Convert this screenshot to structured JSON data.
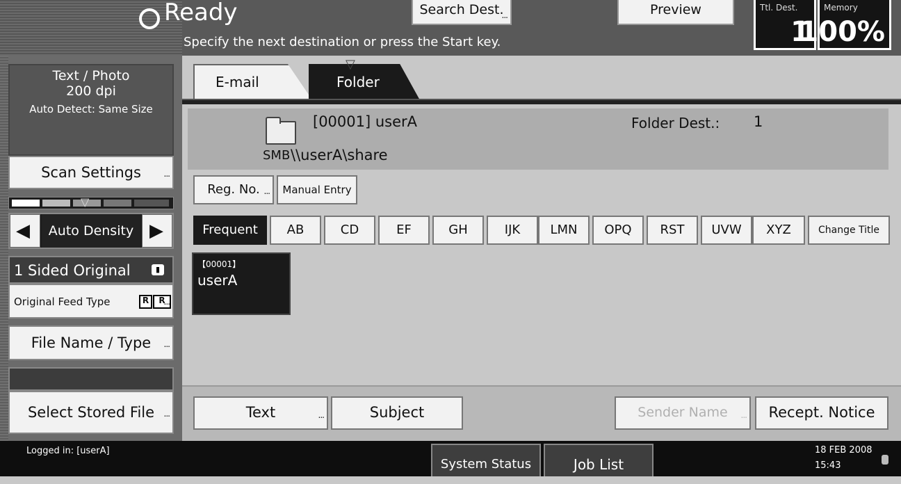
{
  "header": {
    "status": "Ready",
    "message": "Specify the next destination or press the Start key.",
    "search_dest_label": "Search Dest.",
    "preview_label": "Preview",
    "ttl_dest_label": "Ttl. Dest.",
    "ttl_dest_value": "1",
    "memory_label": "Memory",
    "memory_value": "100%"
  },
  "left_panel": {
    "scan_mode": "Text / Photo",
    "resolution": "200 dpi",
    "size_mode": "Auto Detect: Same Size",
    "scan_settings": "Scan Settings",
    "density_label": "Auto Density",
    "sided_original": "1 Sided Original",
    "feed_type": "Original Feed Type",
    "file_name_type": "File Name / Type",
    "select_stored_file": "Select Stored File"
  },
  "tabs": [
    {
      "label": "E-mail",
      "active": false
    },
    {
      "label": "Folder",
      "active": true
    }
  ],
  "destination": {
    "title": "[00001] userA",
    "protocol": "SMB",
    "path": "\\\\userA\\share",
    "count_label": "Folder Dest.:",
    "count_value": "1"
  },
  "entry_buttons": {
    "reg_no": "Reg. No.",
    "manual_entry": "Manual Entry"
  },
  "index_tabs": [
    "Frequent",
    "AB",
    "CD",
    "EF",
    "GH",
    "IJK",
    "LMN",
    "OPQ",
    "RST",
    "UVW",
    "XYZ"
  ],
  "change_title": "Change Title",
  "dest_tiles": [
    {
      "reg": "【00001】",
      "name": "userA"
    }
  ],
  "bottom_buttons": {
    "text": "Text",
    "subject": "Subject",
    "sender_name": "Sender Name",
    "recept_notice": "Recept. Notice"
  },
  "status_bar": {
    "logged_in": "Logged in: [userA]",
    "system_status": "System Status",
    "job_list": "Job List",
    "date": "18 FEB  2008",
    "time": "15:43"
  },
  "colors": {
    "header_bg": "#595959",
    "active_tab": "#1a1a1a",
    "status_bar_bg": "#0e0e0e"
  }
}
